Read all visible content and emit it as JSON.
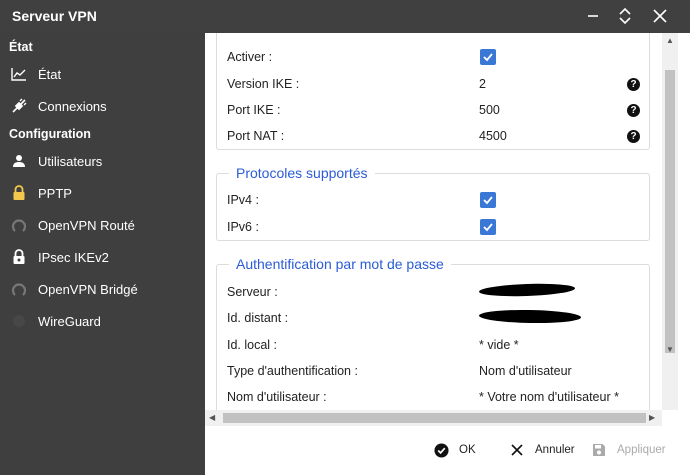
{
  "window": {
    "title": "Serveur VPN"
  },
  "sidebar": {
    "sections": [
      {
        "label": "État",
        "items": [
          {
            "label": "État",
            "icon": "chart-icon"
          },
          {
            "label": "Connexions",
            "icon": "plug-icon"
          }
        ]
      },
      {
        "label": "Configuration",
        "items": [
          {
            "label": "Utilisateurs",
            "icon": "user-icon"
          },
          {
            "label": "PPTP",
            "icon": "lock-icon"
          },
          {
            "label": "OpenVPN Routé",
            "icon": "openvpn-icon"
          },
          {
            "label": "IPsec IKEv2",
            "icon": "lock-icon"
          },
          {
            "label": "OpenVPN Bridgé",
            "icon": "openvpn-icon"
          },
          {
            "label": "WireGuard",
            "icon": "wireguard-icon"
          }
        ]
      }
    ]
  },
  "general": {
    "rows": [
      {
        "label": "Activer :",
        "checked": true
      },
      {
        "label": "Version IKE :",
        "value": "2",
        "help": true
      },
      {
        "label": "Port IKE :",
        "value": "500",
        "help": true
      },
      {
        "label": "Port NAT :",
        "value": "4500",
        "help": true
      }
    ]
  },
  "protocols": {
    "title": "Protocoles supportés",
    "rows": [
      {
        "label": "IPv4 :",
        "checked": true
      },
      {
        "label": "IPv6 :",
        "checked": true
      }
    ]
  },
  "auth": {
    "title": "Authentification par mot de passe",
    "rows": [
      {
        "label": "Serveur :",
        "value": ""
      },
      {
        "label": "Id. distant :",
        "value": ""
      },
      {
        "label": "Id. local :",
        "value": "* vide *"
      },
      {
        "label": "Type d'authentification :",
        "value": "Nom d'utilisateur"
      },
      {
        "label": "Nom d'utilisateur :",
        "value": "* Votre nom d'utilisateur *"
      }
    ]
  },
  "footer": {
    "ok": "OK",
    "cancel": "Annuler",
    "apply": "Appliquer"
  },
  "colors": {
    "accent": "#2a5cd6",
    "checkbox": "#3a78d6",
    "sidebar_bg": "#3f3f3f",
    "titlebar_bg": "#404040"
  }
}
